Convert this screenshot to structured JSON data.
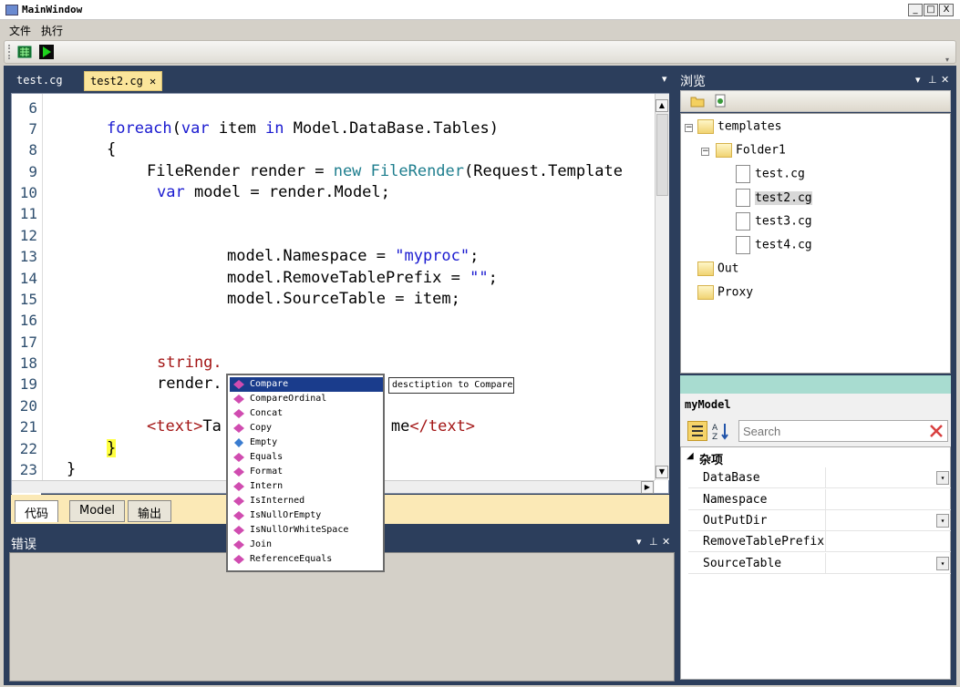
{
  "window": {
    "title": "MainWindow",
    "buttons": [
      "_",
      "□",
      "X"
    ]
  },
  "menu": [
    "文件",
    "执行"
  ],
  "toolbar": {
    "buttons": [
      "grid-icon",
      "run-icon"
    ]
  },
  "doc_tabs": [
    {
      "label": "test.cg"
    },
    {
      "label": "test2.cg",
      "close": "✕"
    }
  ],
  "tab_menu_glyph": "▾",
  "editor": {
    "line_numbers": [
      "6",
      "7",
      "8",
      "9",
      "10",
      "11",
      "12",
      "13",
      "14",
      "15",
      "16",
      "17",
      "18",
      "19",
      "20",
      "21",
      "22",
      "23"
    ],
    "lines": {
      "l7a": "foreach",
      "l7b": "(",
      "l7c": "var",
      "l7d": " item ",
      "l7e": "in",
      "l7f": " Model.DataBase.Tables)",
      "l8": "{",
      "l9a": "FileRender render = ",
      "l9b": "new",
      "l9c": " FileRender",
      "l9d": "(Request.Template",
      "l10a": "var",
      "l10b": " model = render.Model;",
      "l13a": "model.Namespace = ",
      "l13b": "\"myproc\"",
      "l13c": ";",
      "l14a": "model.RemoveTablePrefix = ",
      "l14b": "\"\"",
      "l14c": ";",
      "l15": "model.SourceTable = item;",
      "l18": "string.",
      "l19": "render.",
      "l21a": "<text>",
      "l21b": "Ta",
      "l21c": "me",
      "l21d": "</text>",
      "l22": "}",
      "l23": "}"
    }
  },
  "bottom_tabs": [
    "代码",
    "Model",
    "输出"
  ],
  "error_panel": {
    "title": "错误",
    "controls": [
      "▾",
      "⊥",
      "✕"
    ]
  },
  "browse_panel": {
    "title": "浏览",
    "controls": [
      "▾",
      "⊥",
      "✕"
    ]
  },
  "tree": {
    "templates": "templates",
    "folder1": "Folder1",
    "files": [
      "test.cg",
      "test2.cg",
      "test3.cg",
      "test4.cg"
    ],
    "out": "Out",
    "proxy": "Proxy",
    "collapse": "−"
  },
  "properties": {
    "object": "myModel",
    "search_placeholder": "Search",
    "category": "杂项",
    "rows": [
      "DataBase",
      "Namespace",
      "OutPutDir",
      "RemoveTablePrefix",
      "SourceTable"
    ],
    "dropdown_glyph": "▾"
  },
  "autocomplete": {
    "items": [
      "Compare",
      "CompareOrdinal",
      "Concat",
      "Copy",
      "Empty",
      "Equals",
      "Format",
      "Intern",
      "IsInterned",
      "IsNullOrEmpty",
      "IsNullOrWhiteSpace",
      "Join",
      "ReferenceEquals"
    ],
    "selected": "Compare",
    "tooltip": "desctiption to Compare"
  },
  "colors": {
    "frame": "#2c3e5c",
    "active_tab": "#fbe59a",
    "keyword": "#1a1ad0",
    "type": "#1e7e8e",
    "string": "#a31515",
    "selection": "#1a3c8c"
  }
}
